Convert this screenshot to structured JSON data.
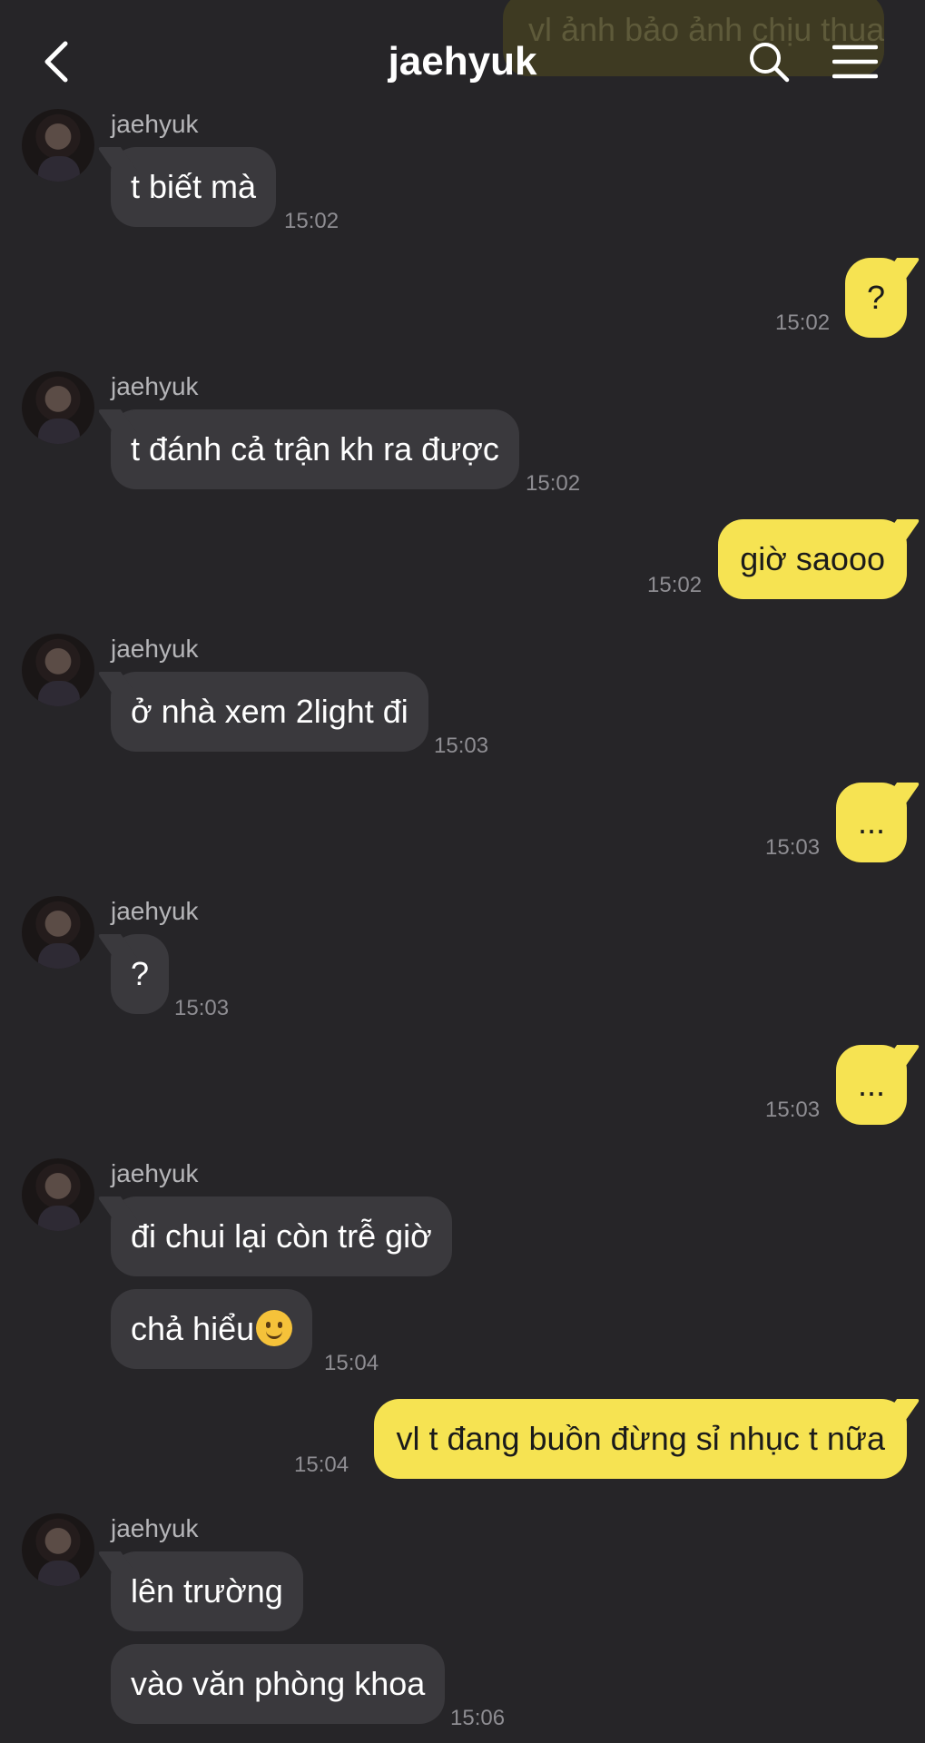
{
  "header": {
    "title": "jaehyuk",
    "ghost_message": "vl ảnh bảo ảnh chịu thua",
    "back_icon": "chevron-left-icon",
    "search_icon": "search-icon",
    "menu_icon": "hamburger-menu-icon"
  },
  "colors": {
    "background": "#262528",
    "incoming_bubble": "#3a393d",
    "outgoing_bubble": "#f6e352",
    "timestamp": "#8e8d92"
  },
  "messages": [
    {
      "sender": "jaehyuk",
      "text": "t biết mà",
      "time": "15:02"
    },
    {
      "text": "?",
      "time": "15:02"
    },
    {
      "sender": "jaehyuk",
      "text": "t đánh cả trận kh ra được",
      "time": "15:02"
    },
    {
      "text": "giờ saooo",
      "time": "15:02"
    },
    {
      "sender": "jaehyuk",
      "text": "ở nhà xem 2light đi",
      "time": "15:03"
    },
    {
      "text": "...",
      "time": "15:03"
    },
    {
      "sender": "jaehyuk",
      "text": "?",
      "time": "15:03"
    },
    {
      "text": "...",
      "time": "15:03"
    },
    {
      "sender": "jaehyuk",
      "text": "đi chui lại còn trễ giờ"
    },
    {
      "text": "chả hiểu",
      "emoji": "slightly-smiling-face-emoji",
      "time": "15:04"
    },
    {
      "text": "vl t đang buồn đừng sỉ nhục t nữa",
      "time": "15:04"
    },
    {
      "sender": "jaehyuk",
      "text": "lên trường"
    },
    {
      "text": "vào văn phòng khoa",
      "time": "15:06"
    }
  ]
}
